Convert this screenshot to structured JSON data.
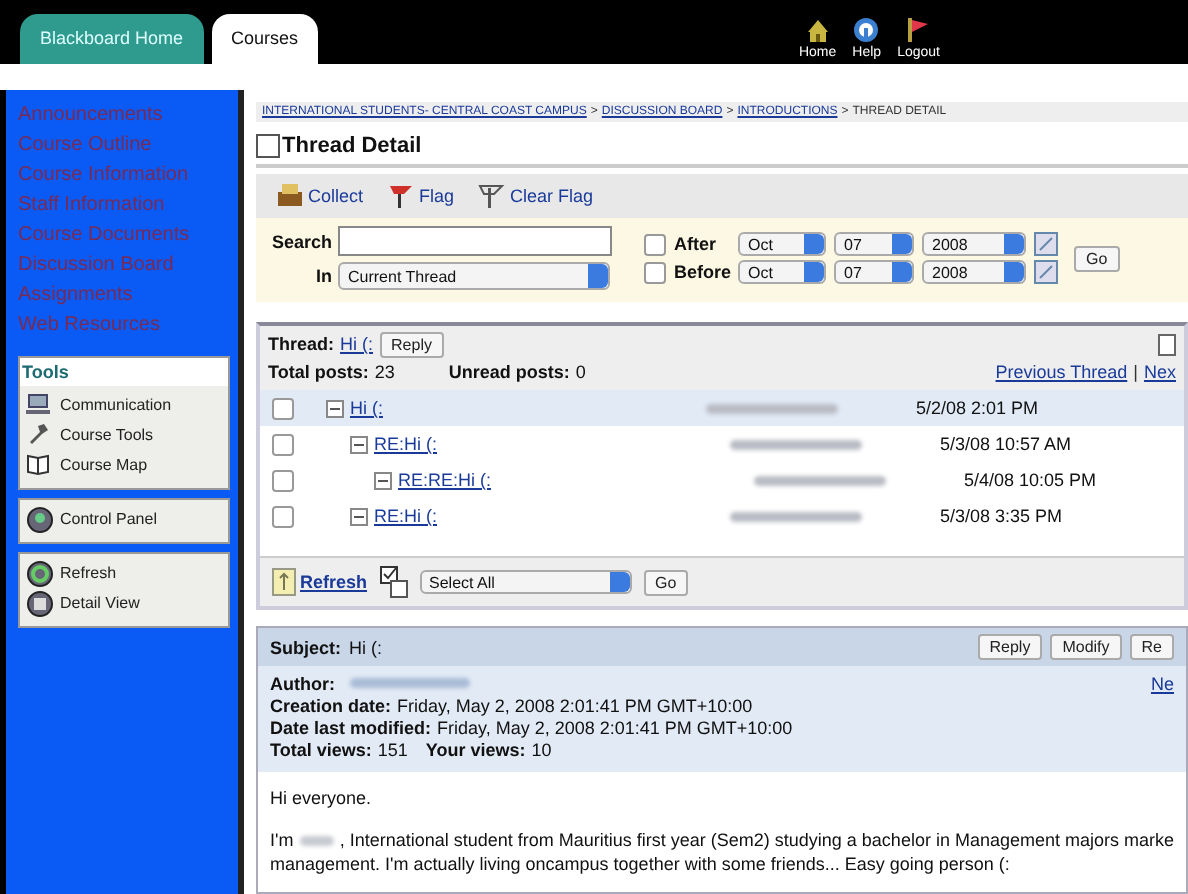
{
  "top_tabs": [
    {
      "label": "Blackboard Home",
      "selected": false
    },
    {
      "label": "Courses",
      "selected": true
    }
  ],
  "top_links": [
    {
      "label": "Home",
      "kind": "home"
    },
    {
      "label": "Help",
      "kind": "help"
    },
    {
      "label": "Logout",
      "kind": "logout"
    }
  ],
  "sidebar": {
    "links": [
      "Announcements",
      "Course Outline",
      "Course Information",
      "Staff Information",
      "Course Documents",
      "Discussion Board",
      "Assignments",
      "Web Resources"
    ],
    "tools": {
      "title": "Tools",
      "items": [
        {
          "label": "Communication",
          "kind": "communication"
        },
        {
          "label": "Course Tools",
          "kind": "tools"
        },
        {
          "label": "Course Map",
          "kind": "map"
        }
      ]
    },
    "control_panel": "Control Panel",
    "view_items": [
      {
        "label": "Refresh",
        "kind": "refresh"
      },
      {
        "label": "Detail View",
        "kind": "detail"
      }
    ]
  },
  "breadcrumb": {
    "separator": ">",
    "items": [
      {
        "label": "INTERNATIONAL STUDENTS- CENTRAL COAST CAMPUS",
        "link": true
      },
      {
        "label": "DISCUSSION BOARD",
        "link": true
      },
      {
        "label": "INTRODUCTIONS",
        "link": true
      },
      {
        "label": "THREAD DETAIL",
        "link": false
      }
    ]
  },
  "page_title": "Thread Detail",
  "actions": [
    {
      "label": "Collect",
      "kind": "collect"
    },
    {
      "label": "Flag",
      "kind": "flag"
    },
    {
      "label": "Clear Flag",
      "kind": "clear_flag"
    }
  ],
  "search": {
    "label": "Search",
    "in_label": "In",
    "scope": "Current Thread",
    "go": "Go",
    "dates": [
      {
        "label": "After",
        "checked": false,
        "month": "Oct",
        "day": "07",
        "year": "2008"
      },
      {
        "label": "Before",
        "checked": false,
        "month": "Oct",
        "day": "07",
        "year": "2008"
      }
    ]
  },
  "thread": {
    "label": "Thread:",
    "title": "Hi (:",
    "reply": "Reply",
    "total_label": "Total posts:",
    "total": "23",
    "unread_label": "Unread posts:",
    "unread": "0",
    "prev": "Previous Thread",
    "separator": "|",
    "next": "Nex",
    "posts": [
      {
        "title": "Hi (:",
        "author_redacted": true,
        "date": "5/2/08 2:01 PM",
        "checked": false,
        "selected": true,
        "children": [
          {
            "title": "RE:Hi (:",
            "author_redacted": true,
            "date": "5/3/08 10:57 AM",
            "checked": false,
            "selected": false,
            "children": [
              {
                "title": "RE:RE:Hi (:",
                "author_redacted": true,
                "date": "5/4/08 10:05 PM",
                "checked": false,
                "selected": false
              }
            ]
          },
          {
            "title": "RE:Hi (:",
            "author_redacted": true,
            "date": "5/3/08 3:35 PM",
            "checked": false,
            "selected": false
          }
        ]
      }
    ],
    "refresh": "Refresh",
    "select": "Select All",
    "go": "Go"
  },
  "message": {
    "subject_label": "Subject:",
    "subject": "Hi (:",
    "buttons": [
      "Reply",
      "Modify",
      "Re"
    ],
    "author_label": "Author:",
    "author_redacted": true,
    "side_link": "Ne",
    "meta": [
      {
        "label": "Creation date:",
        "value": "Friday, May 2, 2008 2:01:41 PM GMT+10:00"
      },
      {
        "label": "Date last modified:",
        "value": "Friday, May 2, 2008 2:01:41 PM GMT+10:00"
      }
    ],
    "views_label": "Total views:",
    "views": "151",
    "your_label": "Your views:",
    "your": "10",
    "greeting": "Hi everyone.",
    "intro": {
      "before": "I'm",
      "redacted": true,
      "after": ", International student from Mauritius first year (Sem2) studying a bachelor in Management majors marke"
    },
    "intro_line2": "management. I'm actually living oncampus together with some friends... Easy going person (:"
  }
}
